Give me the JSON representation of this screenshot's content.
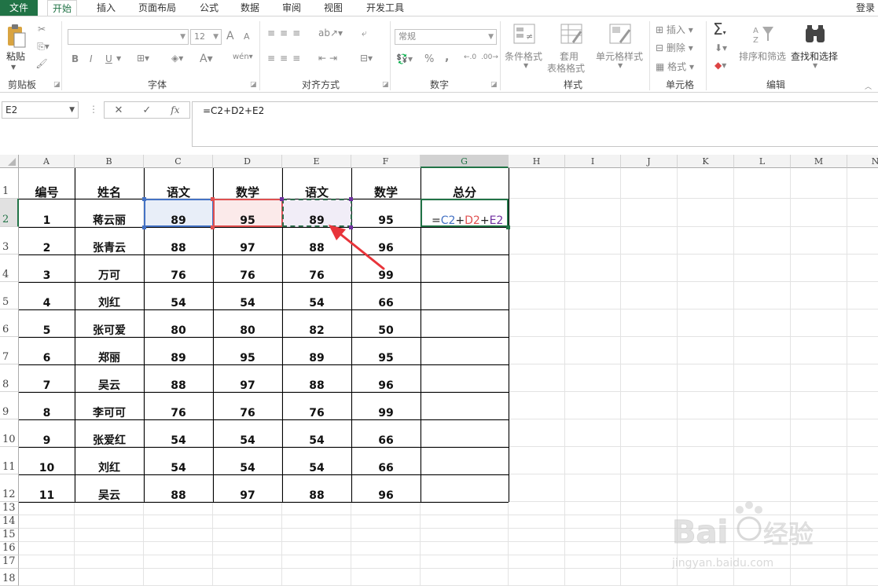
{
  "tabs": {
    "file": "文件",
    "items": [
      "开始",
      "插入",
      "页面布局",
      "公式",
      "数据",
      "审阅",
      "视图",
      "开发工具"
    ],
    "active": "开始",
    "login": "登录"
  },
  "ribbon": {
    "clipboard": {
      "label": "剪贴板",
      "paste": "粘贴"
    },
    "font": {
      "label": "字体",
      "size": "12",
      "bold": "B",
      "italic": "I",
      "underline": "U",
      "grow": "A",
      "shrink": "A",
      "color_a": "A",
      "wen": "wén"
    },
    "alignment": {
      "label": "对齐方式"
    },
    "number": {
      "label": "数字",
      "format": "常规",
      "percent": "%",
      "comma": ","
    },
    "styles": {
      "label": "样式",
      "conditional": "条件格式",
      "table_format_1": "套用",
      "table_format_2": "表格格式",
      "cell_styles": "单元格样式"
    },
    "cells": {
      "label": "单元格",
      "insert": "插入",
      "delete": "删除",
      "format": "格式"
    },
    "editing": {
      "label": "编辑",
      "sort_filter": "排序和筛选",
      "find_select": "查找和选择",
      "sigma": "Σ"
    }
  },
  "formula_bar": {
    "name_box": "E2",
    "formula": "=C2+D2+E2",
    "fx": "fx"
  },
  "columns": [
    "A",
    "B",
    "C",
    "D",
    "E",
    "F",
    "G",
    "H",
    "I",
    "J",
    "K",
    "L",
    "M",
    "N"
  ],
  "rows": [
    "1",
    "2",
    "3",
    "4",
    "5",
    "6",
    "7",
    "8",
    "9",
    "10",
    "11",
    "12",
    "13",
    "14",
    "15",
    "16",
    "17",
    "18"
  ],
  "table": {
    "headers": [
      "编号",
      "姓名",
      "语文",
      "数学",
      "语文",
      "数学",
      "总分"
    ],
    "rows": [
      [
        "1",
        "蒋云丽",
        "89",
        "95",
        "89",
        "95"
      ],
      [
        "2",
        "张青云",
        "88",
        "97",
        "88",
        "96"
      ],
      [
        "3",
        "万可",
        "76",
        "76",
        "76",
        "99"
      ],
      [
        "4",
        "刘红",
        "54",
        "54",
        "54",
        "66"
      ],
      [
        "5",
        "张可爱",
        "80",
        "80",
        "82",
        "50"
      ],
      [
        "6",
        "郑丽",
        "89",
        "95",
        "89",
        "95"
      ],
      [
        "7",
        "吴云",
        "88",
        "97",
        "88",
        "96"
      ],
      [
        "8",
        "李可可",
        "76",
        "76",
        "76",
        "99"
      ],
      [
        "9",
        "张爱红",
        "54",
        "54",
        "54",
        "66"
      ],
      [
        "10",
        "刘红",
        "54",
        "54",
        "54",
        "66"
      ],
      [
        "11",
        "吴云",
        "88",
        "97",
        "88",
        "96"
      ]
    ]
  },
  "edit_cell": {
    "eq": "=",
    "c": "C2",
    "d": "D2",
    "e": "E2",
    "plus": "+"
  },
  "colors": {
    "accent": "#217346",
    "ref_c": "#4472c4",
    "ref_d": "#e05050",
    "ref_e": "#7030a0",
    "arrow": "#e8343a"
  },
  "watermark": {
    "brand": "Baidu",
    "suffix": "经验",
    "url": "jingyan.baidu.com"
  }
}
